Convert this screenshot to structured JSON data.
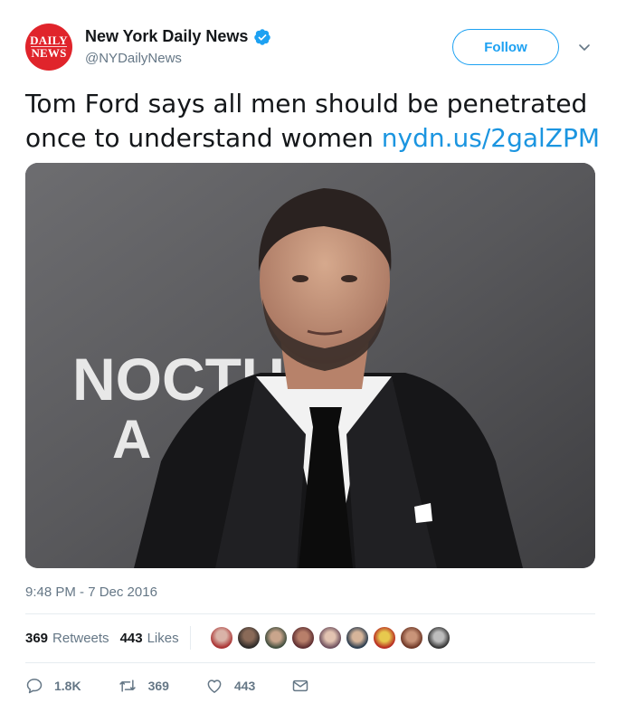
{
  "account": {
    "avatar_line1": "DAILY",
    "avatar_line2": "NEWS",
    "display_name": "New York Daily News",
    "handle": "@NYDailyNews",
    "verified": true,
    "follow_label": "Follow"
  },
  "tweet": {
    "text": "Tom Ford says all men should be penetrated once to understand women ",
    "link": "nydn.us/2galZPM",
    "media_sign_text": "NOCTU AL",
    "media_sign_text_line2": "A",
    "timestamp": "9:48 PM - 7 Dec 2016"
  },
  "stats": {
    "retweets_count": "369",
    "retweets_label": "Retweets",
    "likes_count": "443",
    "likes_label": "Likes"
  },
  "actions": {
    "reply_count": "1.8K",
    "retweet_count": "369",
    "like_count": "443"
  },
  "colors": {
    "accent": "#1da1f2",
    "link": "#1b95e0",
    "brand_red": "#e0242b",
    "muted": "#657786"
  }
}
